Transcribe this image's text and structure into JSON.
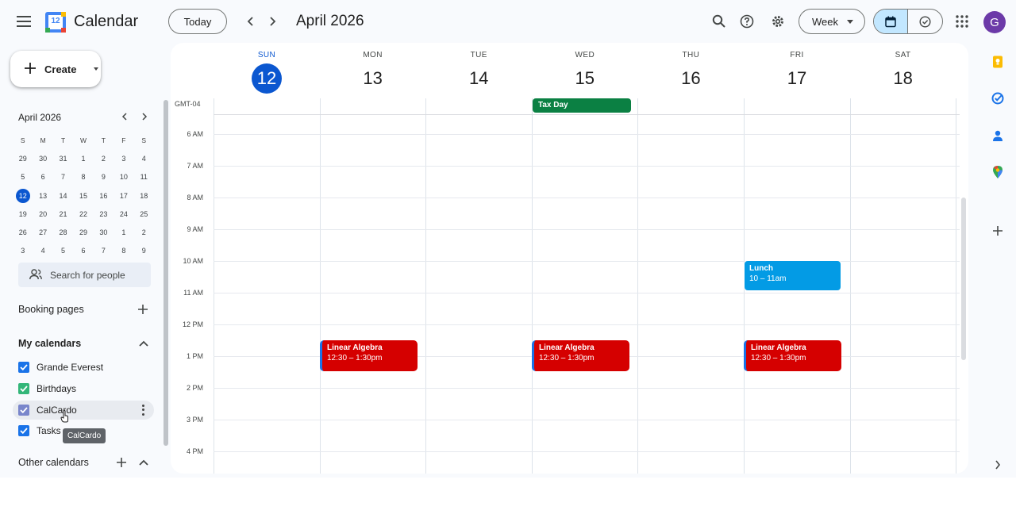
{
  "header": {
    "app_name": "Calendar",
    "logo_day": "12",
    "today_label": "Today",
    "month_title": "April 2026",
    "view_label": "Week",
    "avatar_letter": "G"
  },
  "sidebar": {
    "create_label": "Create",
    "mini_calendar": {
      "title": "April 2026",
      "weekday_heads": [
        "S",
        "M",
        "T",
        "W",
        "T",
        "F",
        "S"
      ],
      "weeks": [
        [
          "29",
          "30",
          "31",
          "1",
          "2",
          "3",
          "4"
        ],
        [
          "5",
          "6",
          "7",
          "8",
          "9",
          "10",
          "11"
        ],
        [
          "12",
          "13",
          "14",
          "15",
          "16",
          "17",
          "18"
        ],
        [
          "19",
          "20",
          "21",
          "22",
          "23",
          "24",
          "25"
        ],
        [
          "26",
          "27",
          "28",
          "29",
          "30",
          "1",
          "2"
        ],
        [
          "3",
          "4",
          "5",
          "6",
          "7",
          "8",
          "9"
        ]
      ],
      "selected": "12"
    },
    "search_people_placeholder": "Search for people",
    "booking_pages_label": "Booking pages",
    "my_calendars_label": "My calendars",
    "my_calendars": [
      {
        "name": "Grande Everest",
        "color": "#1a73e8"
      },
      {
        "name": "Birthdays",
        "color": "#33b679"
      },
      {
        "name": "CalCardo",
        "color": "#7986cb"
      },
      {
        "name": "Tasks",
        "color": "#1a73e8"
      }
    ],
    "tooltip": "CalCardo",
    "other_calendars_label": "Other calendars"
  },
  "week": {
    "timezone": "GMT-04",
    "days": [
      {
        "dow": "SUN",
        "date": "12",
        "today": true
      },
      {
        "dow": "MON",
        "date": "13",
        "today": false
      },
      {
        "dow": "TUE",
        "date": "14",
        "today": false
      },
      {
        "dow": "WED",
        "date": "15",
        "today": false
      },
      {
        "dow": "THU",
        "date": "16",
        "today": false
      },
      {
        "dow": "FRI",
        "date": "17",
        "today": false
      },
      {
        "dow": "SAT",
        "date": "18",
        "today": false
      }
    ],
    "hours": [
      "6 AM",
      "7 AM",
      "8 AM",
      "9 AM",
      "10 AM",
      "11 AM",
      "12 PM",
      "1 PM",
      "2 PM",
      "3 PM",
      "4 PM"
    ],
    "all_day_event": {
      "title": "Tax Day",
      "day": "WED",
      "color": "#0b8043"
    },
    "lunch_event": {
      "title": "Lunch",
      "time": "10 – 11am",
      "day": "FRI",
      "color": "#039be5"
    },
    "class_events": [
      {
        "title": "Linear Algebra",
        "time": "12:30 – 1:30pm",
        "day": "MON",
        "color": "#d50000"
      },
      {
        "title": "Linear Algebra",
        "time": "12:30 – 1:30pm",
        "day": "WED",
        "color": "#d50000"
      },
      {
        "title": "Linear Algebra",
        "time": "12:30 – 1:30pm",
        "day": "FRI",
        "color": "#d50000"
      }
    ]
  }
}
